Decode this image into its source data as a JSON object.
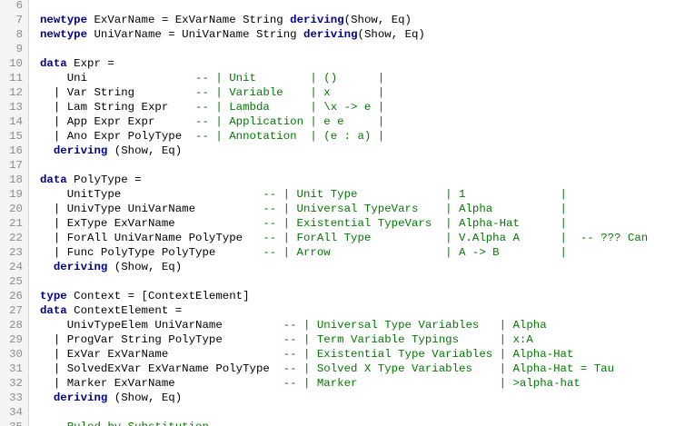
{
  "colors": {
    "keyword": "#00008b",
    "comment": "#007a00",
    "text": "#000000",
    "line_number": "#8c8c8c",
    "gutter_bg": "#f4f4f4"
  },
  "lines": [
    {
      "n": "6",
      "parts": []
    },
    {
      "n": "7",
      "parts": [
        {
          "t": "k",
          "v": "newtype"
        },
        {
          "t": "c",
          "v": " ExVarName = ExVarName String "
        },
        {
          "t": "k",
          "v": "deriving"
        },
        {
          "t": "c",
          "v": "(Show, Eq)"
        }
      ]
    },
    {
      "n": "8",
      "parts": [
        {
          "t": "k",
          "v": "newtype"
        },
        {
          "t": "c",
          "v": " UniVarName = UniVarName String "
        },
        {
          "t": "k",
          "v": "deriving"
        },
        {
          "t": "c",
          "v": "(Show, Eq)"
        }
      ]
    },
    {
      "n": "9",
      "parts": []
    },
    {
      "n": "10",
      "parts": [
        {
          "t": "k",
          "v": "data"
        },
        {
          "t": "c",
          "v": " Expr ="
        }
      ]
    },
    {
      "n": "11",
      "parts": [
        {
          "t": "c",
          "v": "    Uni                "
        },
        {
          "t": "m",
          "v": "-- | Unit        | ()      |"
        }
      ]
    },
    {
      "n": "12",
      "parts": [
        {
          "t": "c",
          "v": "  | Var String         "
        },
        {
          "t": "m",
          "v": "-- | Variable    | x       |"
        }
      ]
    },
    {
      "n": "13",
      "parts": [
        {
          "t": "c",
          "v": "  | Lam String Expr    "
        },
        {
          "t": "m",
          "v": "-- | Lambda      | \\x -> e |"
        }
      ]
    },
    {
      "n": "14",
      "parts": [
        {
          "t": "c",
          "v": "  | App Expr Expr      "
        },
        {
          "t": "m",
          "v": "-- | Application | e e     |"
        }
      ]
    },
    {
      "n": "15",
      "parts": [
        {
          "t": "c",
          "v": "  | Ano Expr PolyType  "
        },
        {
          "t": "m",
          "v": "-- | Annotation  | (e : a) |"
        }
      ]
    },
    {
      "n": "16",
      "parts": [
        {
          "t": "c",
          "v": "  "
        },
        {
          "t": "k",
          "v": "deriving"
        },
        {
          "t": "c",
          "v": " (Show, Eq)"
        }
      ]
    },
    {
      "n": "17",
      "parts": []
    },
    {
      "n": "18",
      "parts": [
        {
          "t": "k",
          "v": "data"
        },
        {
          "t": "c",
          "v": " PolyType ="
        }
      ]
    },
    {
      "n": "19",
      "parts": [
        {
          "t": "c",
          "v": "    UnitType                     "
        },
        {
          "t": "m",
          "v": "-- | Unit Type             | 1              |"
        }
      ]
    },
    {
      "n": "20",
      "parts": [
        {
          "t": "c",
          "v": "  | UnivType UniVarName          "
        },
        {
          "t": "m",
          "v": "-- | Universal TypeVars    | Alpha          |"
        }
      ]
    },
    {
      "n": "21",
      "parts": [
        {
          "t": "c",
          "v": "  | ExType ExVarName             "
        },
        {
          "t": "m",
          "v": "-- | Existential TypeVars  | Alpha-Hat      |"
        }
      ]
    },
    {
      "n": "22",
      "parts": [
        {
          "t": "c",
          "v": "  | ForAll UniVarName PolyType   "
        },
        {
          "t": "m",
          "v": "-- | ForAll Type           | V.Alpha A      |  -- ??? Can"
        }
      ]
    },
    {
      "n": "23",
      "parts": [
        {
          "t": "c",
          "v": "  | Func PolyType PolyType       "
        },
        {
          "t": "m",
          "v": "-- | Arrow                 | A -> B         |"
        }
      ]
    },
    {
      "n": "24",
      "parts": [
        {
          "t": "c",
          "v": "  "
        },
        {
          "t": "k",
          "v": "deriving"
        },
        {
          "t": "c",
          "v": " (Show, Eq)"
        }
      ]
    },
    {
      "n": "25",
      "parts": []
    },
    {
      "n": "26",
      "parts": [
        {
          "t": "k",
          "v": "type"
        },
        {
          "t": "c",
          "v": " Context = [ContextElement]"
        }
      ]
    },
    {
      "n": "27",
      "parts": [
        {
          "t": "k",
          "v": "data"
        },
        {
          "t": "c",
          "v": " ContextElement ="
        }
      ]
    },
    {
      "n": "28",
      "parts": [
        {
          "t": "c",
          "v": "    UnivTypeElem UniVarName         "
        },
        {
          "t": "m",
          "v": "-- | Universal Type Variables   | Alpha"
        }
      ]
    },
    {
      "n": "29",
      "parts": [
        {
          "t": "c",
          "v": "  | ProgVar String PolyType         "
        },
        {
          "t": "m",
          "v": "-- | Term Variable Typings      | x:A"
        }
      ]
    },
    {
      "n": "30",
      "parts": [
        {
          "t": "c",
          "v": "  | ExVar ExVarName                 "
        },
        {
          "t": "m",
          "v": "-- | Existential Type Variables | Alpha-Hat"
        }
      ]
    },
    {
      "n": "31",
      "parts": [
        {
          "t": "c",
          "v": "  | SolvedExVar ExVarName PolyType  "
        },
        {
          "t": "m",
          "v": "-- | Solved X Type Variables    | Alpha-Hat = Tau"
        }
      ]
    },
    {
      "n": "32",
      "parts": [
        {
          "t": "c",
          "v": "  | Marker ExVarName                "
        },
        {
          "t": "m",
          "v": "-- | Marker                     | >alpha-hat"
        }
      ]
    },
    {
      "n": "33",
      "parts": [
        {
          "t": "c",
          "v": "  "
        },
        {
          "t": "k",
          "v": "deriving"
        },
        {
          "t": "c",
          "v": " (Show, Eq)"
        }
      ]
    },
    {
      "n": "34",
      "parts": []
    },
    {
      "n": "35",
      "parts": [
        {
          "t": "m",
          "v": "  --Ruled by Substitution"
        }
      ]
    }
  ]
}
